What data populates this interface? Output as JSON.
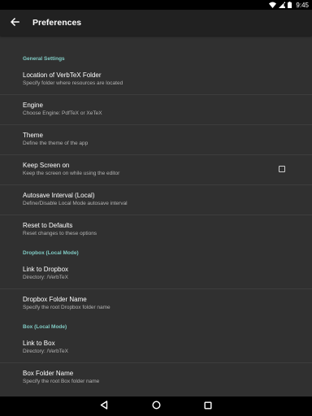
{
  "status_bar": {
    "time": "9:45",
    "icons": [
      "wifi-icon",
      "signal-icon",
      "battery-icon"
    ]
  },
  "toolbar": {
    "title": "Preferences",
    "back_icon": "arrow-back-icon"
  },
  "colors": {
    "accent": "#80CBC4",
    "background": "#303030",
    "toolbar": "#212121"
  },
  "sections": [
    {
      "header": "General Settings",
      "items": [
        {
          "title": "Location of VerbTeX Folder",
          "summary": "Specify folder where resources are located"
        },
        {
          "title": "Engine",
          "summary": "Choose Engine: PdfTeX or XeTeX"
        },
        {
          "title": "Theme",
          "summary": "Define the theme of the app"
        },
        {
          "title": "Keep Screen on",
          "summary": "Keep the screen on while using the editor",
          "checkbox": false
        },
        {
          "title": "Autosave Interval (Local)",
          "summary": "Define/Disable Local Mode autosave interval"
        },
        {
          "title": "Reset to Defaults",
          "summary": "Reset changes to these options"
        }
      ]
    },
    {
      "header": "Dropbox (Local Mode)",
      "items": [
        {
          "title": "Link to Dropbox",
          "summary": "Directory: /VerbTeX"
        },
        {
          "title": "Dropbox Folder Name",
          "summary": "Specify the root Dropbox folder name"
        }
      ]
    },
    {
      "header": "Box (Local Mode)",
      "items": [
        {
          "title": "Link to Box",
          "summary": "Directory: /VerbTeX"
        },
        {
          "title": "Box Folder Name",
          "summary": "Specify the root Box folder name"
        }
      ]
    }
  ],
  "nav_bar": {
    "icons": [
      "back-triangle-icon",
      "home-circle-icon",
      "recents-square-icon"
    ]
  }
}
